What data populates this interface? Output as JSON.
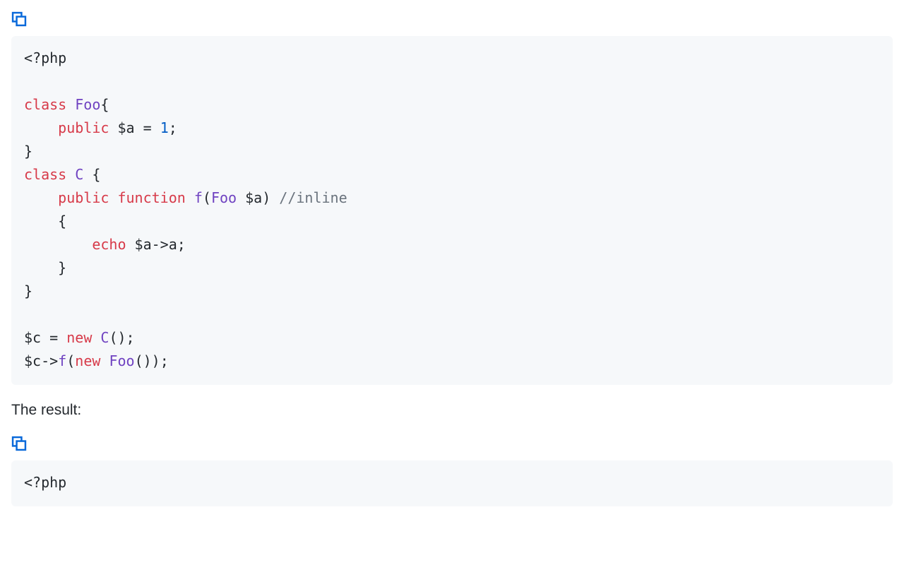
{
  "code_block_1": {
    "tokens": [
      {
        "cls": "tok-open",
        "t": "<?php\n\n"
      },
      {
        "cls": "tok-kw",
        "t": "class"
      },
      {
        "cls": "tok-pn",
        "t": " "
      },
      {
        "cls": "tok-cls",
        "t": "Foo"
      },
      {
        "cls": "tok-pn",
        "t": "{\n    "
      },
      {
        "cls": "tok-kw",
        "t": "public"
      },
      {
        "cls": "tok-pn",
        "t": " "
      },
      {
        "cls": "tok-var",
        "t": "$a"
      },
      {
        "cls": "tok-pn",
        "t": " "
      },
      {
        "cls": "tok-op",
        "t": "="
      },
      {
        "cls": "tok-pn",
        "t": " "
      },
      {
        "cls": "tok-num",
        "t": "1"
      },
      {
        "cls": "tok-pn",
        "t": ";\n}\n"
      },
      {
        "cls": "tok-kw",
        "t": "class"
      },
      {
        "cls": "tok-pn",
        "t": " "
      },
      {
        "cls": "tok-cls",
        "t": "C"
      },
      {
        "cls": "tok-pn",
        "t": " {\n    "
      },
      {
        "cls": "tok-kw",
        "t": "public"
      },
      {
        "cls": "tok-pn",
        "t": " "
      },
      {
        "cls": "tok-kw",
        "t": "function"
      },
      {
        "cls": "tok-pn",
        "t": " "
      },
      {
        "cls": "tok-call",
        "t": "f"
      },
      {
        "cls": "tok-pn",
        "t": "("
      },
      {
        "cls": "tok-cls",
        "t": "Foo"
      },
      {
        "cls": "tok-pn",
        "t": " "
      },
      {
        "cls": "tok-var",
        "t": "$a"
      },
      {
        "cls": "tok-pn",
        "t": ") "
      },
      {
        "cls": "tok-cm",
        "t": "//inline"
      },
      {
        "cls": "tok-pn",
        "t": "\n    {\n        "
      },
      {
        "cls": "tok-kw",
        "t": "echo"
      },
      {
        "cls": "tok-pn",
        "t": " "
      },
      {
        "cls": "tok-var",
        "t": "$a"
      },
      {
        "cls": "tok-op",
        "t": "->"
      },
      {
        "cls": "tok-prop",
        "t": "a"
      },
      {
        "cls": "tok-pn",
        "t": ";\n    }\n}\n\n"
      },
      {
        "cls": "tok-var",
        "t": "$c"
      },
      {
        "cls": "tok-pn",
        "t": " "
      },
      {
        "cls": "tok-op",
        "t": "="
      },
      {
        "cls": "tok-pn",
        "t": " "
      },
      {
        "cls": "tok-kw",
        "t": "new"
      },
      {
        "cls": "tok-pn",
        "t": " "
      },
      {
        "cls": "tok-cls",
        "t": "C"
      },
      {
        "cls": "tok-pn",
        "t": "();\n"
      },
      {
        "cls": "tok-var",
        "t": "$c"
      },
      {
        "cls": "tok-op",
        "t": "->"
      },
      {
        "cls": "tok-call",
        "t": "f"
      },
      {
        "cls": "tok-pn",
        "t": "("
      },
      {
        "cls": "tok-kw",
        "t": "new"
      },
      {
        "cls": "tok-pn",
        "t": " "
      },
      {
        "cls": "tok-cls",
        "t": "Foo"
      },
      {
        "cls": "tok-pn",
        "t": "());"
      }
    ]
  },
  "prose_1": "The result:",
  "code_block_2": {
    "tokens": [
      {
        "cls": "tok-open",
        "t": "<?php\n"
      }
    ]
  }
}
